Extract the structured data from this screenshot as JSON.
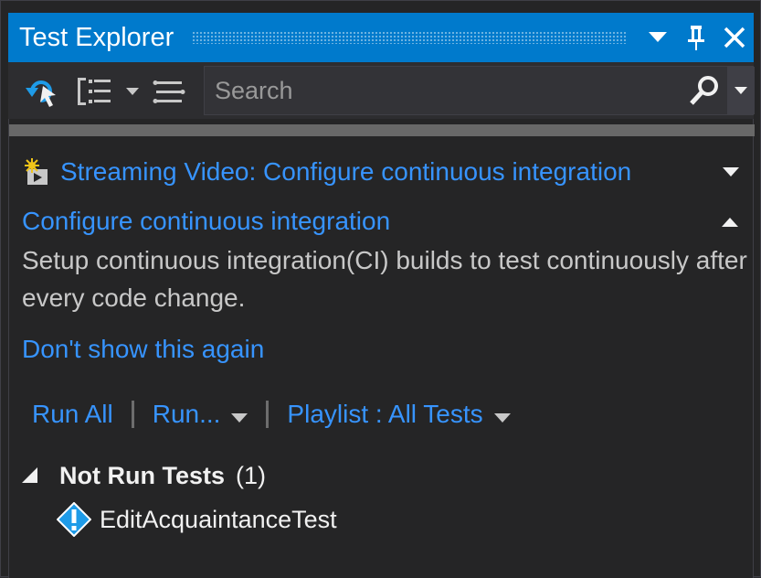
{
  "window": {
    "title": "Test Explorer"
  },
  "toolbar": {
    "search_placeholder": "Search"
  },
  "banner": {
    "video_link": "Streaming Video: Configure continuous integration",
    "section_title": "Configure continuous integration",
    "description": "Setup continuous integration(CI) builds to test continuously after every code change.",
    "dismiss_link": "Don't show this again"
  },
  "actions": {
    "run_all": "Run All",
    "run": "Run...",
    "playlist": "Playlist : All Tests"
  },
  "tests": {
    "group_name": "Not Run Tests",
    "group_count": "(1)",
    "items": [
      {
        "name": "EditAcquaintanceTest",
        "status_icon": "warning-icon"
      }
    ]
  },
  "colors": {
    "accent": "#007acc",
    "link": "#3794ff",
    "background": "#252526"
  }
}
